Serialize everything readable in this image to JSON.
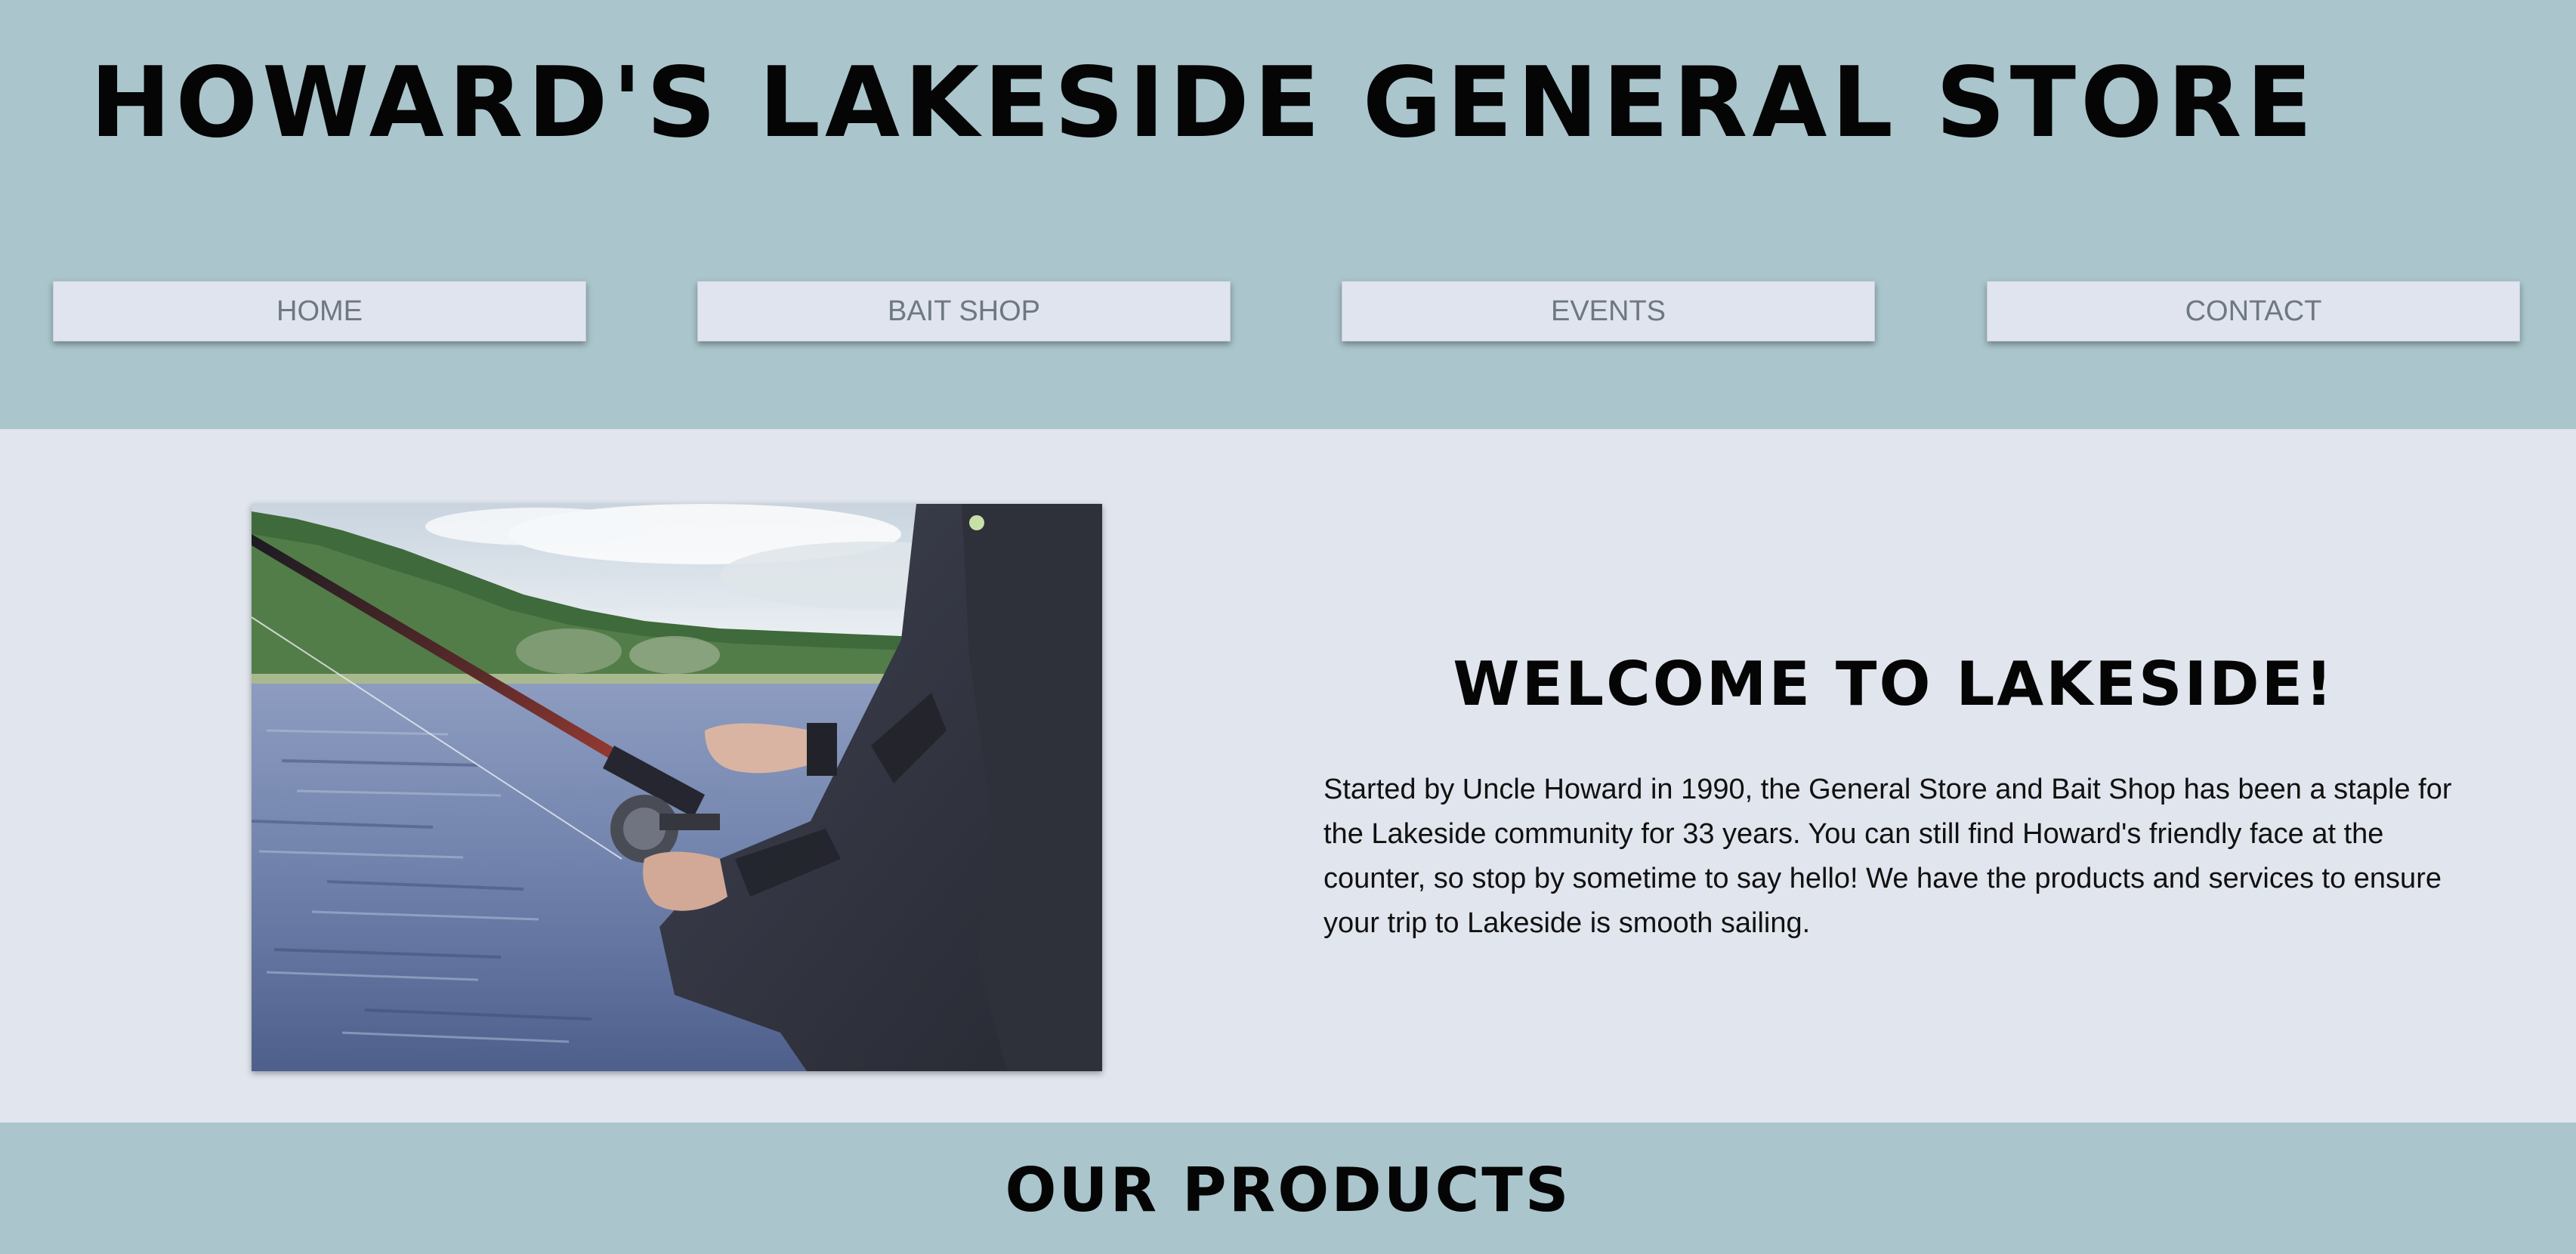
{
  "header": {
    "title": "HOWARD'S LAKESIDE GENERAL STORE",
    "nav": [
      {
        "label": "HOME"
      },
      {
        "label": "BAIT SHOP"
      },
      {
        "label": "EVENTS"
      },
      {
        "label": "CONTACT"
      }
    ]
  },
  "about": {
    "image_icon": "fishing-photo",
    "heading": "WELCOME TO LAKESIDE!",
    "body": "Started by Uncle Howard in 1990, the General Store and Bait Shop has been a staple for the Lakeside community for 33 years. You can still find Howard's friendly face at the counter, so stop by sometime to say hello! We have the products and services to ensure your trip to Lakeside is smooth sailing."
  },
  "products": {
    "heading": "OUR PRODUCTS"
  },
  "colors": {
    "header_bg": "#aac5cc",
    "page_bg": "#e1e5ed",
    "nav_button_bg": "#e0e4ee",
    "nav_text": "#6e7880"
  }
}
